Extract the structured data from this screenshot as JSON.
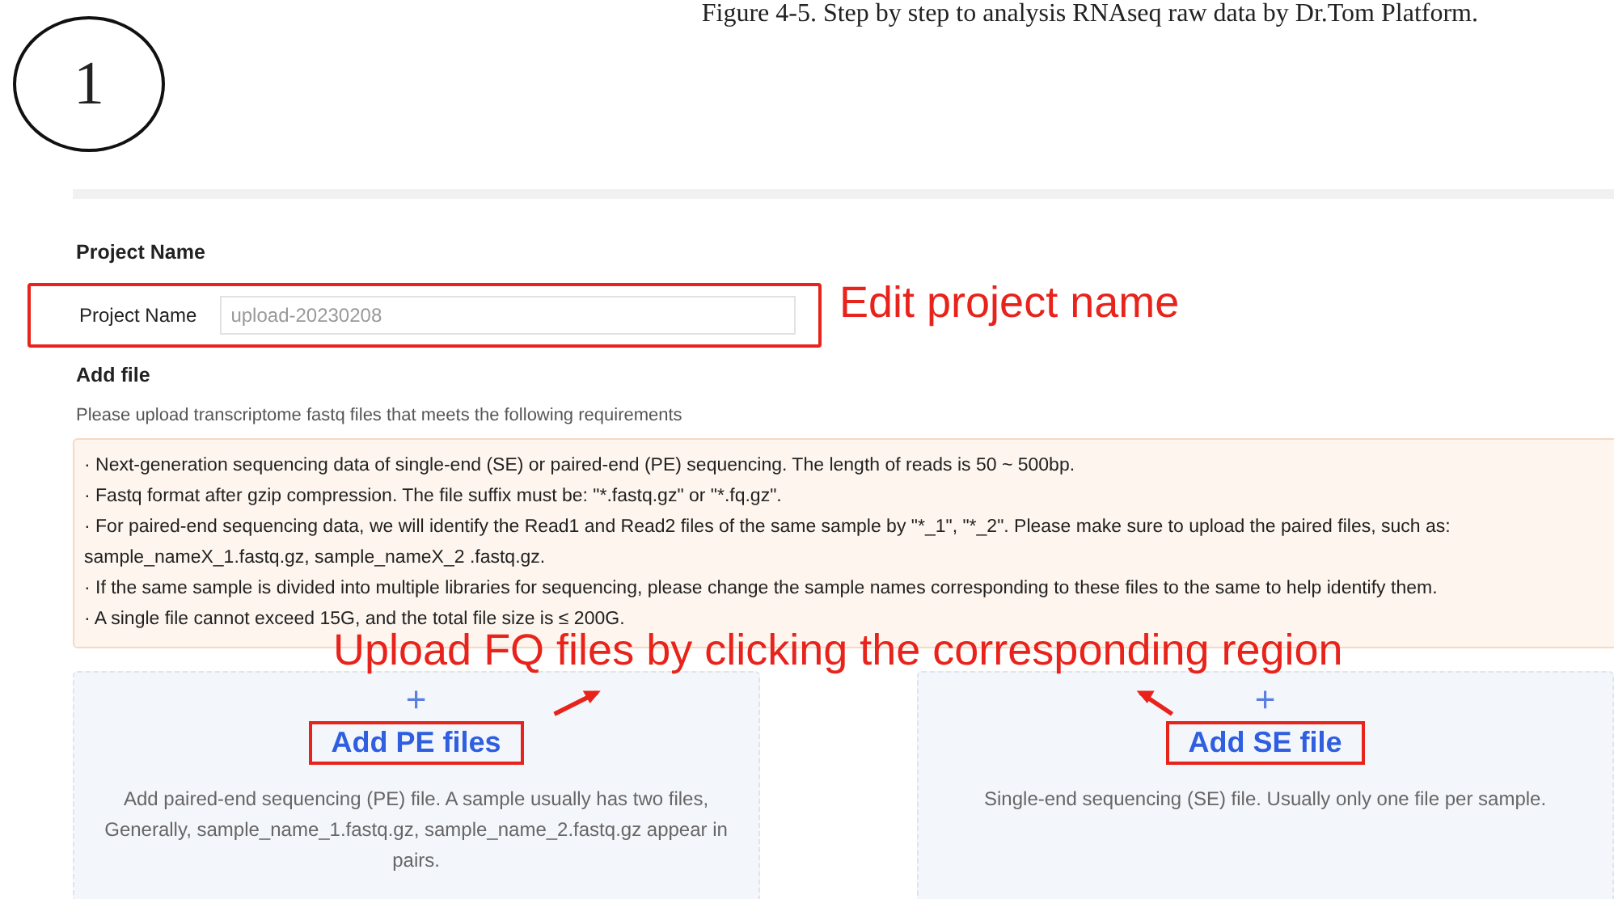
{
  "caption": "Figure 4-5. Step by step to analysis RNAseq raw data by Dr.Tom Platform.",
  "step_badge": "1",
  "form": {
    "section_title": "Project Name",
    "field": {
      "label": "Project Name",
      "value": "upload-20230208",
      "highlighted": true
    },
    "add_file": {
      "title": "Add file",
      "hint": "Please upload transcriptome fastq files that meets the following requirements",
      "requirements": [
        "· Next-generation sequencing data of single-end (SE) or paired-end (PE) sequencing. The length of reads is 50 ~ 500bp.",
        "· Fastq format after gzip compression. The file suffix must be: \"*.fastq.gz\" or \"*.fq.gz\".",
        "· For paired-end sequencing data, we will identify the Read1 and Read2 files of the same sample by \"*_1\", \"*_2\". Please make sure to upload the paired files, such as: sample_nameX_1.fastq.gz, sample_nameX_2 .fastq.gz.",
        "· If the same sample is divided into multiple libraries for sequencing, please change the sample names corresponding to these files to the same to help identify them.",
        "· A single file cannot exceed 15G, and the total file size is ≤ 200G."
      ],
      "upload_areas": [
        {
          "icon": "+",
          "button": "Add PE files",
          "highlighted": true,
          "description": "Add paired-end sequencing (PE) file. A sample usually has two files, Generally, sample_name_1.fastq.gz, sample_name_2.fastq.gz appear in pairs."
        },
        {
          "icon": "+",
          "button": "Add SE file",
          "highlighted": true,
          "description": "Single-end sequencing (SE) file. Usually only one file per sample."
        }
      ]
    }
  },
  "annotations": [
    {
      "kind": "field_note",
      "text": "Edit project name"
    },
    {
      "kind": "upload_note",
      "text": "Upload FQ files by clicking the corresponding region"
    }
  ]
}
